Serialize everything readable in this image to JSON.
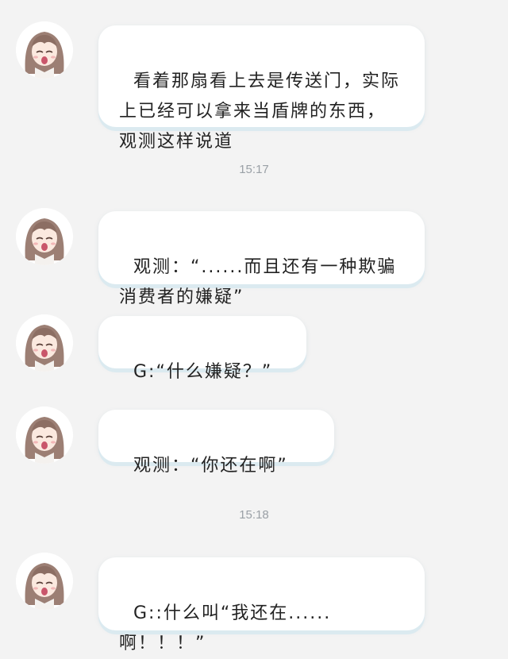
{
  "chat": {
    "messages": [
      {
        "text": "看着那扇看上去是传送门，实际上已经可以拿来当盾牌的东西，观测这样说道"
      },
      {
        "text": "观测：“......而且还有一种欺骗消费者的嫌疑”"
      },
      {
        "text": "G:“什么嫌疑？”"
      },
      {
        "text": "观测：“你还在啊”"
      },
      {
        "text": "G::什么叫“我还在......啊！！！”"
      }
    ],
    "timestamps": [
      "15:17",
      "15:18"
    ]
  },
  "colors": {
    "background": "#f3f3f3",
    "bubble": "#ffffff",
    "bubble_shadow": "#dbeaf0",
    "timestamp_text": "#9aa0a6"
  },
  "icons": {
    "avatar": "anime-girl-avatar-icon"
  }
}
